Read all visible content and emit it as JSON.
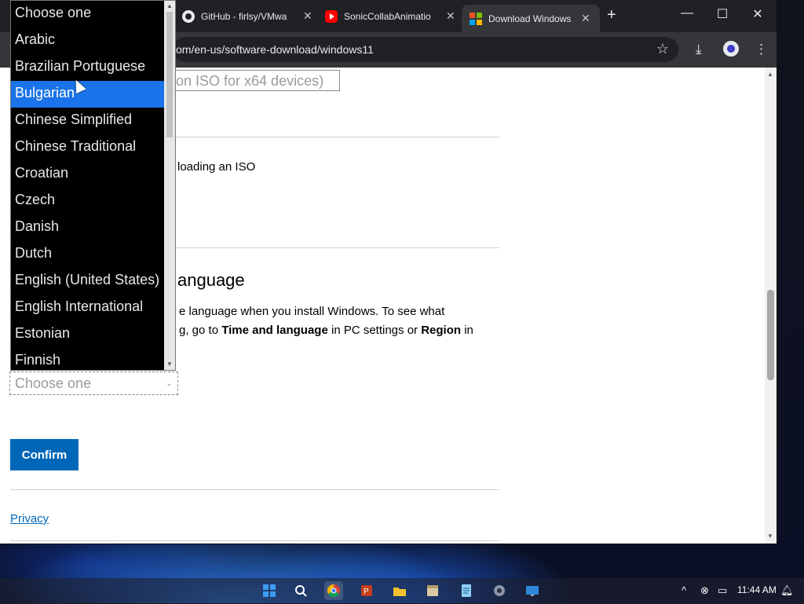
{
  "tabs": [
    {
      "title": "GitHub - firlsy/VMwa",
      "icon": "github-icon"
    },
    {
      "title": "SonicCollabAnimatio",
      "icon": "youtube-icon"
    },
    {
      "title": "Download Windows",
      "icon": "microsoft-icon",
      "active": true
    }
  ],
  "toolbar": {
    "url": "om/en-us/software-download/windows11"
  },
  "page": {
    "edition_select_value": "on ISO for x64 devices)",
    "downloading_text": "loading an ISO",
    "language_heading": "anguage",
    "language_desc_line1": "e language when you install Windows. To see what",
    "language_desc_line2_a": "g, go to ",
    "language_desc_line2_b": "Time and language",
    "language_desc_line2_c": " in PC settings or ",
    "language_desc_line2_d": "Region",
    "language_desc_line2_e": " in",
    "language_select_placeholder": "Choose one",
    "confirm_label": "Confirm",
    "privacy_label": "Privacy"
  },
  "dropdown": {
    "options": [
      "Choose one",
      "Arabic",
      "Brazilian Portuguese",
      "Bulgarian",
      "Chinese Simplified",
      "Chinese Traditional",
      "Croatian",
      "Czech",
      "Danish",
      "Dutch",
      "English (United States)",
      "English International",
      "Estonian",
      "Finnish"
    ],
    "highlighted": "Bulgarian"
  },
  "taskbar": {
    "time": "11:44 AM"
  },
  "colors": {
    "accent": "#0067b8",
    "highlight": "#1a73e8",
    "tabstrip": "#202124",
    "toolbar": "#35363a"
  }
}
